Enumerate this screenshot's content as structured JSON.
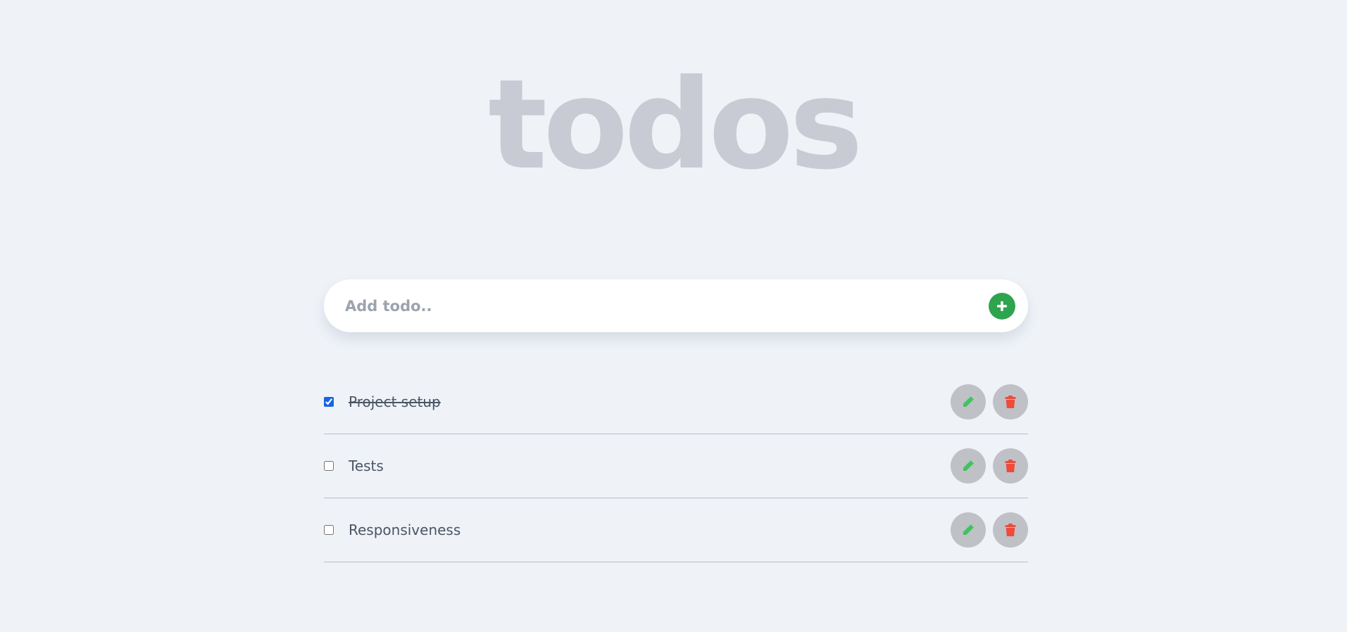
{
  "app": {
    "title": "todos"
  },
  "add_todo": {
    "placeholder": "Add todo..",
    "value": "",
    "button_icon": "plus-icon",
    "button_color": "#2ea44f"
  },
  "todos": [
    {
      "text": "Project setup",
      "completed": true
    },
    {
      "text": "Tests",
      "completed": false
    },
    {
      "text": "Responsiveness",
      "completed": false
    }
  ],
  "actions": {
    "edit_icon": "pencil-icon",
    "edit_color": "#3ec55a",
    "delete_icon": "trash-icon",
    "delete_color": "#ef4a3c"
  },
  "colors": {
    "background": "#eff3f8",
    "title": "#c8cbd3",
    "accent": "#1a64e0"
  }
}
